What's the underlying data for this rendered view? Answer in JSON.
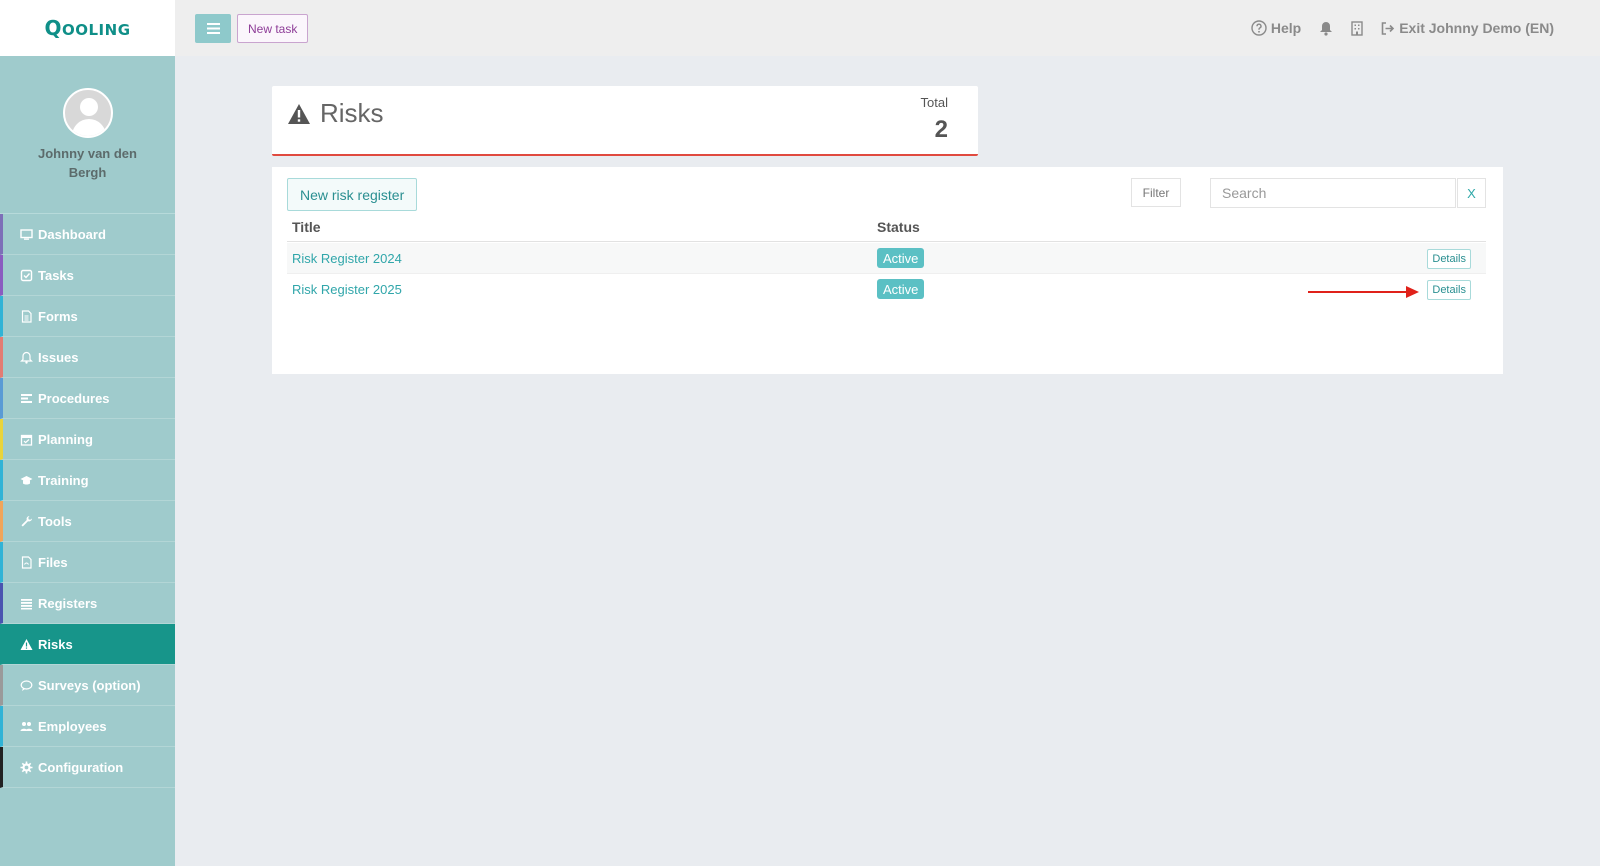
{
  "brand": {
    "logo_text": "Qooling"
  },
  "colors": {
    "accent": "#17958a",
    "sidebar": "#9fcbcc",
    "danger": "#e04a3f",
    "badge": "#5bc0c4"
  },
  "topbar": {
    "new_task_label": "New task",
    "help_label": "Help",
    "exit_label": "Exit Johnny Demo (EN)"
  },
  "user": {
    "name": "Johnny van den Bergh"
  },
  "sidebar": {
    "items": [
      {
        "label": "Dashboard",
        "icon": "monitor-icon",
        "stripe": "#7d6fb8"
      },
      {
        "label": "Tasks",
        "icon": "check-square-icon",
        "stripe": "#8a5cc0"
      },
      {
        "label": "Forms",
        "icon": "document-icon",
        "stripe": "#31b3d6"
      },
      {
        "label": "Issues",
        "icon": "bell-icon",
        "stripe": "#e37c73"
      },
      {
        "label": "Procedures",
        "icon": "list-icon",
        "stripe": "#5a9bd5"
      },
      {
        "label": "Planning",
        "icon": "calendar-icon",
        "stripe": "#e9d43b"
      },
      {
        "label": "Training",
        "icon": "graduation-cap-icon",
        "stripe": "#31b3d6"
      },
      {
        "label": "Tools",
        "icon": "wrench-icon",
        "stripe": "#f0a55a"
      },
      {
        "label": "Files",
        "icon": "file-icon",
        "stripe": "#31b3d6"
      },
      {
        "label": "Registers",
        "icon": "bars-icon",
        "stripe": "#4a54b0"
      },
      {
        "label": "Risks",
        "icon": "warning-icon",
        "stripe": "#17958a",
        "active": true
      },
      {
        "label": "Surveys (option)",
        "icon": "comment-icon",
        "stripe": "#9a9a9a"
      },
      {
        "label": "Employees",
        "icon": "users-icon",
        "stripe": "#31b3d6"
      },
      {
        "label": "Configuration",
        "icon": "gear-icon",
        "stripe": "#222222"
      }
    ]
  },
  "risks_header": {
    "title": "Risks",
    "total_label": "Total",
    "total_value": "2"
  },
  "toolbar": {
    "new_register_label": "New risk register",
    "filter_label": "Filter",
    "search_placeholder": "Search",
    "clear_label": "X"
  },
  "table": {
    "columns": [
      "Title",
      "Status"
    ],
    "rows": [
      {
        "title": "Risk Register 2024",
        "status": "Active",
        "action": "Details"
      },
      {
        "title": "Risk Register 2025",
        "status": "Active",
        "action": "Details"
      }
    ]
  }
}
